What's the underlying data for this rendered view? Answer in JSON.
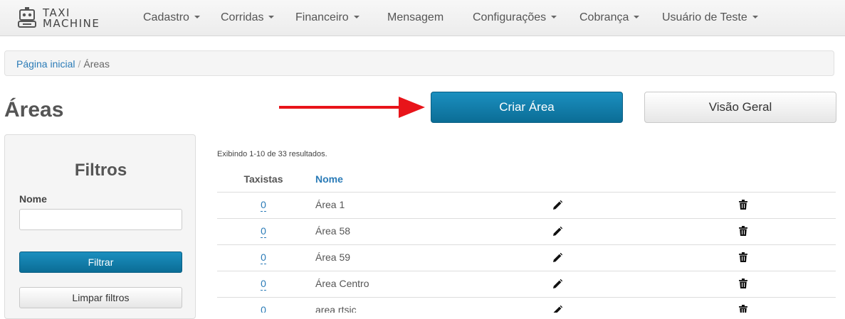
{
  "navbar": {
    "logo": {
      "line1": "TAXI",
      "line2": "MACHINE"
    },
    "items": [
      {
        "label": "Cadastro",
        "dropdown": true
      },
      {
        "label": "Corridas",
        "dropdown": true
      },
      {
        "label": "Financeiro",
        "dropdown": true
      },
      {
        "label": "Mensagem",
        "dropdown": false
      },
      {
        "label": "Configurações",
        "dropdown": true
      },
      {
        "label": "Cobrança",
        "dropdown": true
      },
      {
        "label": "Usuário de Teste",
        "dropdown": true
      }
    ]
  },
  "breadcrumb": {
    "home": "Página inicial",
    "separator": "/",
    "current": "Áreas"
  },
  "page": {
    "title": "Áreas"
  },
  "actions": {
    "create": "Criar Área",
    "overview": "Visão Geral"
  },
  "filters": {
    "title": "Filtros",
    "name_label": "Nome",
    "name_value": "",
    "filter_button": "Filtrar",
    "clear_button": "Limpar filtros"
  },
  "table": {
    "summary": "Exibindo 1-10 de 33 resultados.",
    "headers": {
      "taxistas": "Taxistas",
      "nome": "Nome"
    },
    "rows": [
      {
        "taxistas": "0",
        "nome": "Área 1"
      },
      {
        "taxistas": "0",
        "nome": "Área 58"
      },
      {
        "taxistas": "0",
        "nome": "Área 59"
      },
      {
        "taxistas": "0",
        "nome": "Área Centro"
      },
      {
        "taxistas": "0",
        "nome": "area rtsic"
      }
    ]
  },
  "colors": {
    "primary": "#0b7aa8",
    "link": "#2a7bb7",
    "arrow": "#e8141a",
    "navbar_bg": "#f0f0f0"
  },
  "icons": {
    "edit": "pencil-icon",
    "delete": "trash-icon",
    "arrow": "arrow-right-icon"
  }
}
